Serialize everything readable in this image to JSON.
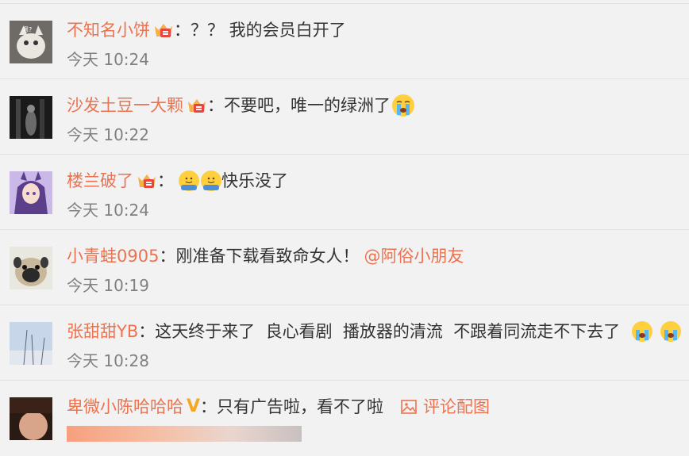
{
  "comments": [
    {
      "username": "不知名小饼",
      "badge": "crown-badge-icon",
      "text": "？？ 我的会员白开了",
      "time": "今天 10:24",
      "avatar_desc": "cat-avatar"
    },
    {
      "username": "沙发土豆一大颗",
      "badge": "crown-badge-icon",
      "text": "不要吧，唯一的绿洲了",
      "trailing_emoji": "crying-face-icon",
      "time": "今天 10:22",
      "avatar_desc": "dark-figure-avatar"
    },
    {
      "username": "楼兰破了",
      "badge": "crown-badge-icon",
      "leading_emojis": [
        "hugging-face-icon",
        "hugging-face-icon"
      ],
      "text": "快乐没了",
      "time": "今天 10:24",
      "avatar_desc": "anime-girl-avatar"
    },
    {
      "username": "小青蛙0905",
      "text": "刚准备下载看致命女人！",
      "mention": "@阿俗小朋友",
      "time": "今天 10:19",
      "avatar_desc": "pug-avatar"
    },
    {
      "username": "张甜甜YB",
      "text": "这天终于来了  良心看剧  播放器的清流  不跟着同流走不下去了 ",
      "trailing_emojis": [
        "crying-face-icon",
        "crying-face-icon"
      ],
      "time": "今天 10:28",
      "avatar_desc": "sky-avatar"
    },
    {
      "username": "卑微小陈哈哈哈",
      "verified": "V",
      "text": "只有广告啦，看不了啦",
      "pic_link": "评论配图",
      "avatar_desc": "dark-portrait-avatar"
    }
  ],
  "colors": {
    "username": "#eb7350",
    "time": "#808080",
    "background": "#f2f2f2",
    "divider": "#e1e1e1"
  }
}
